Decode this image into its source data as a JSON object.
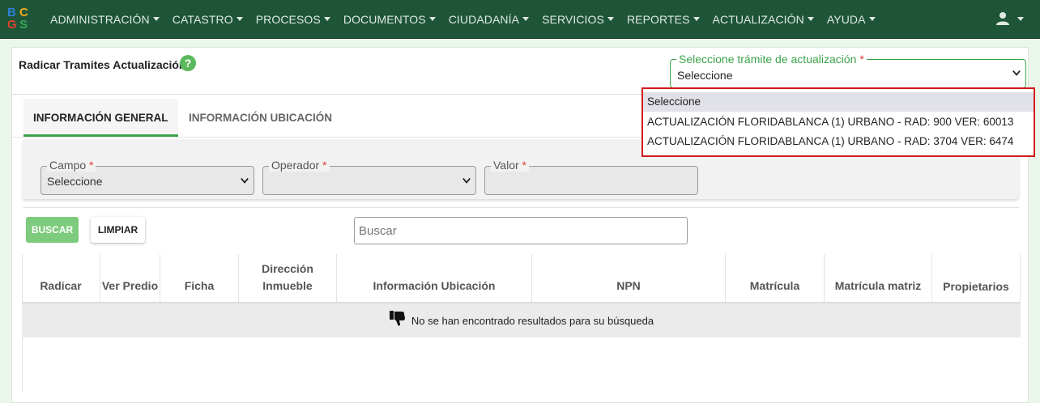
{
  "logo": {
    "letters": [
      "B",
      "C",
      "G",
      "S"
    ],
    "colors": [
      "#2f7fd1",
      "#f2a81d",
      "#e0412f",
      "#35a853"
    ]
  },
  "nav": {
    "items": [
      "ADMINISTRACIÓN",
      "CATASTRO",
      "PROCESOS",
      "DOCUMENTOS",
      "CIUDADANÍA",
      "SERVICIOS",
      "REPORTES",
      "ACTUALIZACIÓN",
      "AYUDA"
    ]
  },
  "page": {
    "title": "Radicar Tramites Actualización",
    "help_icon": "question-icon"
  },
  "tramite_select": {
    "label": "Seleccione trámite de actualización",
    "required_mark": "*",
    "value": "Seleccione",
    "options": [
      "Seleccione",
      "ACTUALIZACIÓN   FLORIDABLANCA   (1) URBANO - RAD: 900 VER: 60013",
      "ACTUALIZACIÓN   FLORIDABLANCA   (1) URBANO - RAD: 3704 VER: 6474"
    ]
  },
  "tabs": [
    "INFORMACIÓN GENERAL",
    "INFORMACIÓN UBICACIÓN"
  ],
  "filters": {
    "campo": {
      "label": "Campo",
      "value": "Seleccione"
    },
    "operador": {
      "label": "Operador",
      "value": ""
    },
    "valor": {
      "label": "Valor",
      "value": ""
    },
    "required_mark": "*"
  },
  "buttons": {
    "buscar": "BUSCAR",
    "limpiar": "LIMPIAR"
  },
  "search": {
    "placeholder": "Buscar"
  },
  "table": {
    "columns": [
      "Radicar",
      "Ver Predio",
      "Ficha",
      "Dirección Inmueble",
      "Información Ubicación",
      "NPN",
      "Matrícula",
      "Matrícula matriz",
      "Propietarios"
    ],
    "empty_message": "No se han encontrado resultados para su búsqueda"
  },
  "colors": {
    "navbar": "#1e5538",
    "accent": "#3aa34a",
    "dropdown_highlight": "#d0191c"
  }
}
